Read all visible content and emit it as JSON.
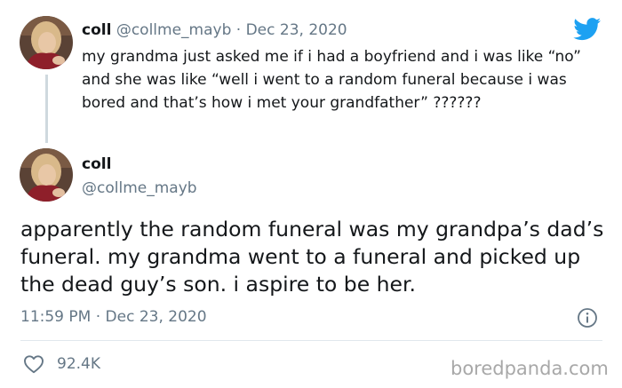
{
  "tweet_reply": {
    "display_name": "coll",
    "handle": "@collme_mayb",
    "separator": "·",
    "date": "Dec 23, 2020",
    "text": "my grandma just asked me if i had a boyfriend and i was like “no” and she was like “well i went to a random funeral because i was bored and that’s how i met your grandfather” ??????"
  },
  "tweet_main": {
    "display_name": "coll",
    "handle": "@collme_mayb",
    "text": "apparently the random funeral was my grandpa’s dad’s funeral. my grandma went to a funeral and picked up the dead guy’s son. i aspire to be her.",
    "time": "11:59 PM",
    "separator": "·",
    "date": "Dec 23, 2020",
    "like_count": "92.4K"
  },
  "watermark": "boredpanda.com",
  "icons": {
    "brand": "twitter-bird-icon",
    "info": "info-icon",
    "like": "heart-icon"
  },
  "colors": {
    "twitter_blue": "#1da1f2",
    "secondary_text": "#657786",
    "primary_text": "#14171a"
  }
}
